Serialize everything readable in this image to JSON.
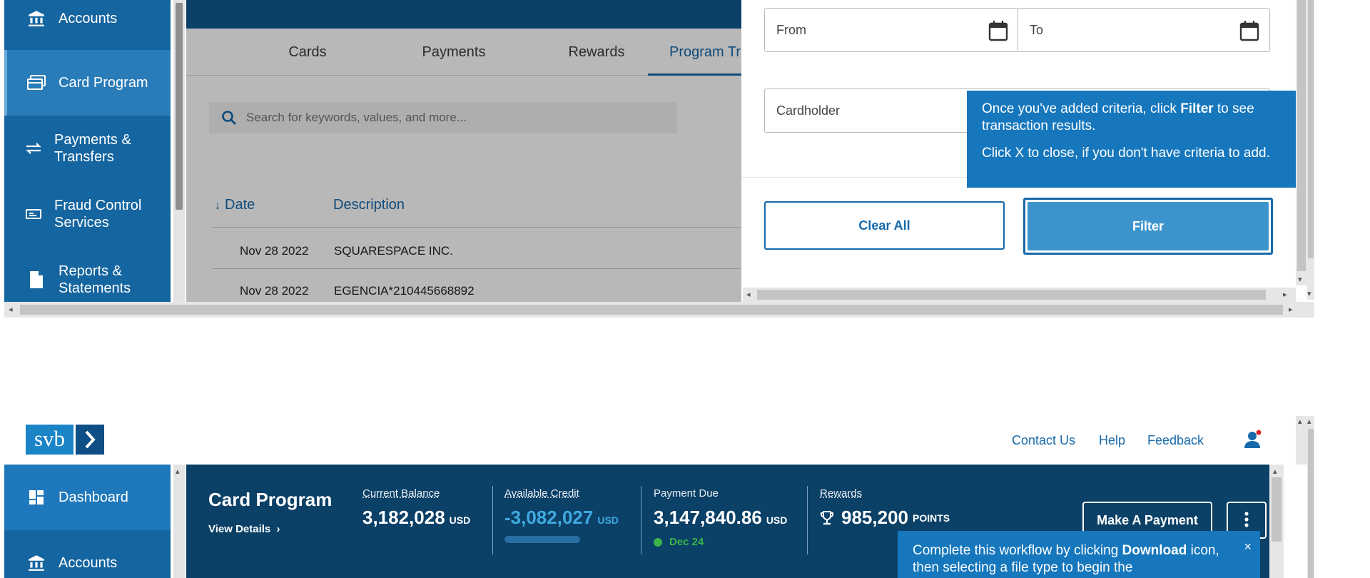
{
  "top": {
    "sidebar": {
      "items": [
        {
          "label": "Accounts",
          "icon": "bank-icon"
        },
        {
          "label": "Card Program",
          "icon": "card-icon"
        },
        {
          "label": "Payments & Transfers",
          "icon": "transfer-arrows-icon"
        },
        {
          "label": "Fraud Control Services",
          "icon": "id-card-icon"
        },
        {
          "label": "Reports & Statements",
          "icon": "document-icon"
        }
      ]
    },
    "tabs": [
      "Cards",
      "Payments",
      "Rewards",
      "Program Tr"
    ],
    "search_placeholder": "Search for keywords, values, and more...",
    "table": {
      "headers": [
        "Date",
        "Description"
      ],
      "rows": [
        {
          "date": "Nov 28 2022",
          "description": "SQUARESPACE INC."
        },
        {
          "date": "Nov 28 2022",
          "description": "EGENCIA*210445668892"
        }
      ]
    },
    "filter": {
      "from_label": "From",
      "to_label": "To",
      "cardholder_label": "Cardholder",
      "clear_all": "Clear All",
      "filter_button": "Filter"
    },
    "tooltip": {
      "line1_pre": "Once you've added criteria, click ",
      "line1_bold": "Filter",
      "line1_post": " to see transaction results.",
      "line2": "Click X to close, if you don't have criteria to add.",
      "close": "×"
    }
  },
  "bottom": {
    "logo_text": "svb",
    "links": [
      "Contact Us",
      "Help",
      "Feedback"
    ],
    "sidebar": [
      {
        "label": "Dashboard",
        "icon": "dashboard-icon"
      },
      {
        "label": "Accounts",
        "icon": "bank-icon"
      }
    ],
    "summary": {
      "title": "Card Program",
      "view_details": "View Details",
      "current_balance": {
        "label": "Current Balance",
        "value": "3,182,028",
        "unit": "USD"
      },
      "available_credit": {
        "label": "Available Credit",
        "value": "-3,082,027",
        "unit": "USD"
      },
      "payment_due": {
        "label": "Payment Due",
        "value": "3,147,840.86",
        "unit": "USD",
        "date": "Dec 24"
      },
      "rewards": {
        "label": "Rewards",
        "value": "985,200",
        "unit": "POINTS"
      },
      "make_payment": "Make A Payment"
    },
    "tooltip": {
      "pre": "Complete this workflow by clicking ",
      "bold": "Download",
      "post": " icon, then selecting a file type to begin the",
      "close": "×"
    }
  },
  "colors": {
    "sidebar": "#1565a0",
    "navy": "#0b4067",
    "accent": "#1769aa",
    "tooltip": "#1677bd",
    "credit": "#3fa9e0",
    "due_dot": "#3cb44a"
  }
}
